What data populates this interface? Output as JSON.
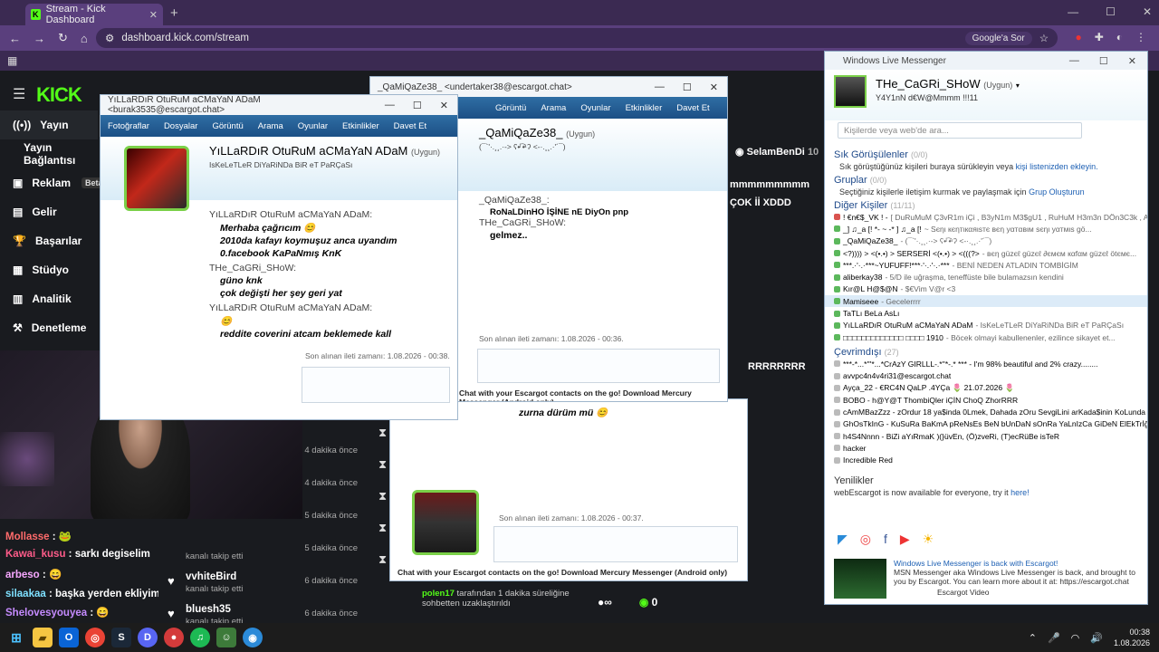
{
  "browser": {
    "tab_title": "Stream - Kick Dashboard",
    "url": "dashboard.kick.com/stream",
    "lens_label": "Google'a Sor"
  },
  "kick": {
    "logo": "KICK",
    "sidebar": [
      {
        "label": "Yayın",
        "icon": "broadcast-icon",
        "active": true
      },
      {
        "label": "Yayın Bağlantısı",
        "icon": "",
        "active": false
      },
      {
        "label": "Reklam",
        "icon": "ad-icon",
        "badge": "Beta"
      },
      {
        "label": "Gelir",
        "icon": "revenue-icon"
      },
      {
        "label": "Başarılar",
        "icon": "trophy-icon"
      },
      {
        "label": "Stüdyo",
        "icon": "studio-icon"
      },
      {
        "label": "Analitik",
        "icon": "analytics-icon"
      },
      {
        "label": "Denetleme",
        "icon": "moderation-icon"
      }
    ],
    "chat": [
      {
        "user": "Mollasse",
        "color": "#ff6b6b",
        "text": " : 🐸"
      },
      {
        "user": "Kawai_kusu",
        "color": "#ff5c8a",
        "text": " : sarkı degiselim"
      },
      {
        "user": "arbeso",
        "color": "#f7a8ff",
        "text": " : 😄"
      },
      {
        "user": "silaakaa",
        "color": "#7ee0ff",
        "text": " : başka yerden ekliyim mi😊"
      },
      {
        "user": "Shelovesyouyea",
        "color": "#c58bff",
        "text": " : 😄"
      }
    ],
    "follows": [
      {
        "name": "",
        "sub": "",
        "time": "4 dakika önce"
      },
      {
        "name": "",
        "sub": "",
        "time": "4 dakika önce"
      },
      {
        "name": "",
        "sub": "",
        "time": "5 dakika önce"
      },
      {
        "name": "",
        "sub": "kanalı takip etti",
        "time": "5 dakika önce"
      },
      {
        "name": "vvhiteBird",
        "sub": "kanalı takip etti",
        "time": "6 dakika önce"
      },
      {
        "name": "bluesh35",
        "sub": "kanalı takip etti",
        "time": "6 dakika önce"
      }
    ],
    "stream_overlay": {
      "user": "SelamBenDi",
      "count": "10",
      "spam1": "mmmmmmmmm",
      "spam2": "ÇOK İİ XDDD",
      "spam3": "RRRRRRRR",
      "bottom_user": "polen17",
      "bottom_text": "tarafından 1 dakika süreliğine sohbetten uzaklaştırıldı",
      "zero": "0"
    }
  },
  "chat1": {
    "title": "YıLLaRDıR OtuRuM aCMaYaN ADaM <burak3535@escargot.chat>",
    "menu": [
      "Fotoğraflar",
      "Dosyalar",
      "Görüntü",
      "Arama",
      "Oyunlar",
      "Etkinlikler",
      "Davet Et"
    ],
    "contact_name": "YıLLaRDıR OtuRuM aCMaYaN ADaM",
    "contact_status": "(Uygun)",
    "contact_psm": "IsKeLeTLeR DiYaRiNDa BiR eT PaRÇaSı",
    "messages": [
      {
        "who": "YıLLaRDıR OtuRuM aCMaYaN ADaM:",
        "lines": [
          "Merhaba çağrıcım 😊",
          "2010da kafayı koymuşuz anca uyandım",
          "0.facebook KaPaNmış KnK"
        ]
      },
      {
        "who": "THe_CaGRi_SHoW:",
        "lines": [
          "güno knk",
          "çok değişti her şey geri yat"
        ]
      },
      {
        "who": "YıLLaRDıR OtuRuM aCMaYaN ADaM:",
        "lines": [
          "😊",
          "reddite coverini atcam beklemede kall"
        ]
      }
    ],
    "last_msg": "Son alınan ileti zamanı: 1.08.2026 - 00:38."
  },
  "chat2": {
    "title": "_QaMiQaZe38_ <undertaker38@escargot.chat>",
    "menu": [
      "Görüntü",
      "Arama",
      "Oyunlar",
      "Etkinlikler",
      "Davet Et"
    ],
    "contact_name": "_QaMiQaZe38_",
    "contact_status": "(Uygun)",
    "contact_psm": "(¯`'·.¸¸.·->  ʕ•ͥ͡ •ͣ ʔ  <-·.¸¸.·'´¯)",
    "who1": "_QaMiQaZe38_:",
    "line1": "RoNaLDinHO İŞİNE nE DiyOn pnp",
    "who2": "THe_CaGRi_SHoW:",
    "line2": "gelmez..",
    "last_msg": "Son alınan ileti zamanı: 1.08.2026 - 00:36.",
    "footer": "Chat with your Escargot contacts on the go! Download Mercury Messenger (Android only)"
  },
  "chat3": {
    "line": "zurna dürüm mü 😊",
    "last_msg": "Son alınan ileti zamanı: 1.08.2026 - 00:37.",
    "footer": "Chat with your Escargot contacts on the go! Download Mercury Messenger (Android only)"
  },
  "wlm": {
    "title": "Windows Live Messenger",
    "name": "THe_CaGRi_SHoW",
    "status": "(Uygun)",
    "psm": "Y4Y1nN d€W@Mmmm !!!11",
    "search_placeholder": "Kişilerde veya web'de ara...",
    "favorites_title": "Sık Görüşülenler",
    "favorites_count": "(0/0)",
    "favorites_note": "Sık görüştüğünüz kişileri buraya sürükleyin veya",
    "favorites_link": "kişi listenizden ekleyin.",
    "groups_title": "Gruplar",
    "groups_count": "(0/0)",
    "groups_note": "Seçtiğiniz kişilerle iletişim kurmak ve paylaşmak için",
    "groups_link": "Grup Oluşturun",
    "others_title": "Diğer Kişiler",
    "others_count": "(11/11)",
    "others": [
      {
        "name": "! €n€$_VK ! -",
        "psm": "[ DuRuMuM Ç3vR1m iÇi , B3yN1m M3$gU1 , RuHuM H3m3n DÖn3C3k , A...",
        "color": "#d9534f"
      },
      {
        "name": "_] ♫_a [! *- ~ -* ] ♫_a [!",
        "psm": "~ Sєηι кєηтιкαяιѕтє вєη уαтαвιм ѕєηι уαтмιѕ gö...",
        "color": "#5cb85c"
      },
      {
        "name": "_QaMiQaZe38_",
        "psm": "- (¯`'·.¸¸.·-> ʕ•ͥ͡ •ͣ ʔ <-·.¸¸.·'´¯)",
        "color": "#5cb85c"
      },
      {
        "name": "<?)))) > <(•.•) > SERSERİ <(•.•) > <(((?>",
        "psm": "- вєη güzєℓ güzєℓ ∂ємєм кαfαм güzєℓ ötємє...",
        "color": "#5cb85c"
      },
      {
        "name": "***.·'·.·***~YUFUFF!***·'·.·'·.·***",
        "psm": "- BENİ NEDEN ATLADIN TOMBİGİM",
        "color": "#5cb85c"
      },
      {
        "name": "aliberkay38",
        "psm": "- 5/D ile uğraşma, teneffüste bile bulamazsın kendini",
        "color": "#5cb85c"
      },
      {
        "name": "Kır@L H@$@N",
        "psm": "- $€Vim V@r <3",
        "color": "#5cb85c"
      },
      {
        "name": "Mamiseee",
        "psm": "- Gecelerrrr",
        "color": "#5cb85c",
        "selected": true
      },
      {
        "name": "TaTLı BeLa AsLı",
        "psm": "",
        "color": "#5cb85c"
      },
      {
        "name": "YıLLaRDıR OtuRuM aCMaYaN ADaM",
        "psm": "- IsKeLeTLeR DiYaRiNDa BiR eT PaRÇaSı",
        "color": "#5cb85c"
      },
      {
        "name": "□□□□□□□□□□□□□ □□□□ 1910",
        "psm": "- Böcek olmayi kabullenenler, ezilince sikayet et...",
        "color": "#5cb85c"
      }
    ],
    "online_title": "Çevrimdışı",
    "online_count": "(27)",
    "offline": [
      "***-*...*'''*...*CrAzY GIRLLL-.*''*-.* ***  -  I'm 98% beautiful and 2% crazy........",
      "avvpc4n4v4ri31@escargot.chat",
      "Ayça_22  -  €RC4N QaLP .4YÇa 🌷 21.07.2026 🌷",
      "BOBO  -  h@Y@T ThombiQler iÇİN ChoQ ZhorRRR",
      "cAmMBazZzz  -  zOrdur 18 ya$inda 0Lmek, Dahada zOru SevgiLini arKada$inin KoLunda gö...",
      "GhOsTkInG  -  KuSuRa BaKmA pReNsEs BeN bUnDaN sOnRa YaLnIzCa GiDeN ElEkTrİğİ BeK...",
      "h4S4Nnnn  -  BiZi aYıRmaK )(}üvEn, (Ö)zveRi, (T)ecRüBe isTeR",
      "hacker",
      "Incredible Red"
    ],
    "news_title": "Yenilikler",
    "news_text": "webEscargot is now available for everyone, try it",
    "news_link": "here!",
    "promo_title": "Windows Live Messenger is back with Escargot!",
    "promo_text": "MSN Messenger aka Windows Live Messenger is back, and brought to you by Escargot. You can learn more about it at: https://escargot.chat",
    "promo_video": "Escargot Video"
  },
  "taskbar": {
    "time": "00:38",
    "date": "1.08.2026"
  }
}
